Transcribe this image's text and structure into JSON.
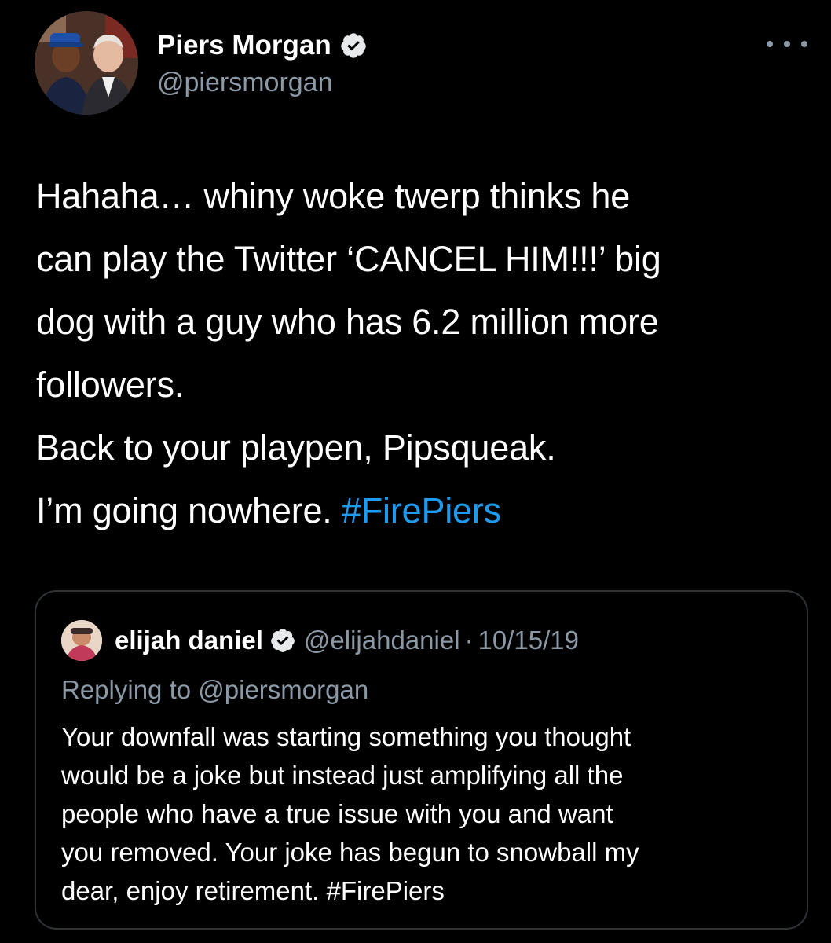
{
  "tweet": {
    "author": {
      "display_name": "Piers Morgan",
      "handle": "@piersmorgan",
      "verified_icon": "verified-badge-icon"
    },
    "more_icon": "more-options-icon",
    "body_lines": [
      "Hahaha… whiny woke twerp thinks he",
      "can play the Twitter ‘CANCEL HIM!!!’ big",
      "dog with a guy who has 6.2 million more",
      "followers.",
      "Back to your playpen, Pipsqueak.",
      "I’m going nowhere. "
    ],
    "hashtag": "#FirePiers"
  },
  "quoted_tweet": {
    "display_name": "elijah daniel",
    "handle": "@elijahdaniel",
    "separator": "·",
    "date": "10/15/19",
    "replying_to": "Replying to @piersmorgan",
    "text": "Your downfall was starting something you thought\nwould be a joke but instead just amplifying all the\npeople who have a true issue with you and want\nyou removed. Your joke has begun to snowball my\ndear, enjoy retirement. #FirePiers"
  },
  "colors": {
    "background": "#000000",
    "text": "#ffffff",
    "secondary": "#8b98a5",
    "link": "#1d9bf0",
    "border": "#2f3336"
  }
}
